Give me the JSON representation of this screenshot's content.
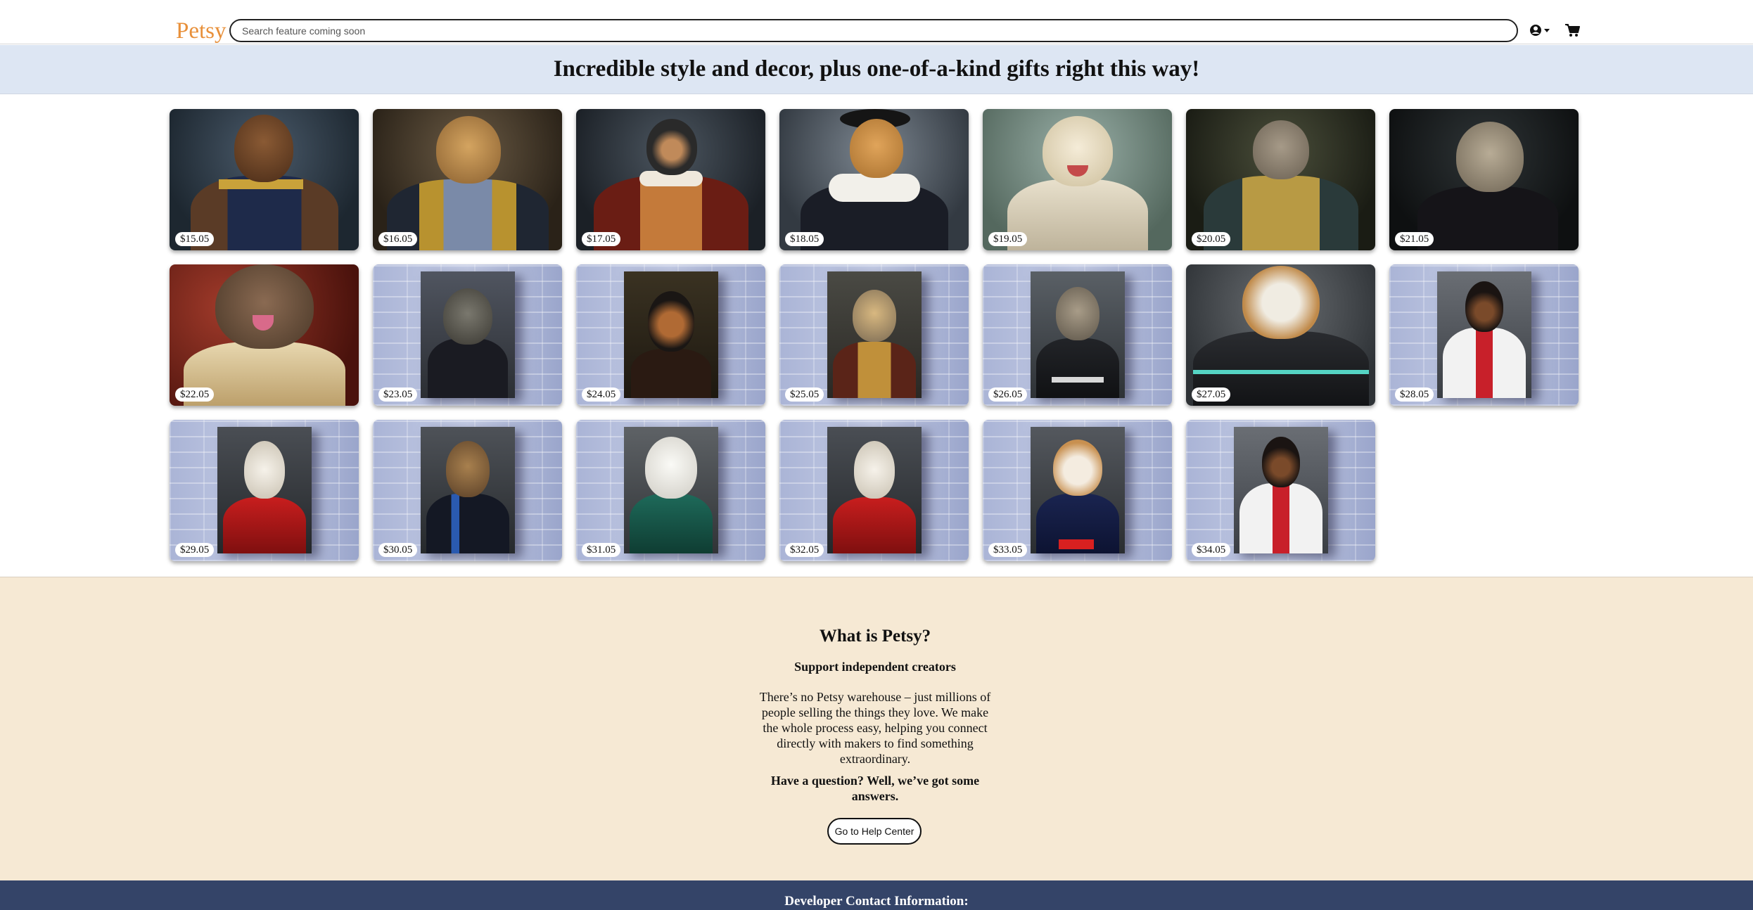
{
  "header": {
    "logo": "Petsy",
    "search_placeholder": "Search feature coming soon",
    "user_icon": "user-dropdown-icon",
    "cart_icon": "cart-icon"
  },
  "banner": {
    "headline": "Incredible style and decor, plus one-of-a-kind gifts right this way!"
  },
  "products": [
    {
      "price": "$15.05"
    },
    {
      "price": "$16.05"
    },
    {
      "price": "$17.05"
    },
    {
      "price": "$18.05"
    },
    {
      "price": "$19.05"
    },
    {
      "price": "$20.05"
    },
    {
      "price": "$21.05"
    },
    {
      "price": "$22.05"
    },
    {
      "price": "$23.05"
    },
    {
      "price": "$24.05"
    },
    {
      "price": "$25.05"
    },
    {
      "price": "$26.05"
    },
    {
      "price": "$27.05"
    },
    {
      "price": "$28.05"
    },
    {
      "price": "$29.05"
    },
    {
      "price": "$30.05"
    },
    {
      "price": "$31.05"
    },
    {
      "price": "$32.05"
    },
    {
      "price": "$33.05"
    },
    {
      "price": "$34.05"
    }
  ],
  "info": {
    "title": "What is Petsy?",
    "subtitle": "Support independent creators",
    "body": "There’s no Petsy warehouse – just millions of people selling the things they love. We make the whole process easy, helping you connect directly with makers to find something extraordinary.",
    "question": "Have a question? Well, we’ve got some answers.",
    "help_button": "Go to Help Center"
  },
  "footer": {
    "heading": "Developer Contact Information:"
  },
  "colors": {
    "brand": "#e8903a",
    "banner_bg": "#dde6f3",
    "info_bg": "#f6e9d4",
    "footer_bg": "#344468"
  }
}
